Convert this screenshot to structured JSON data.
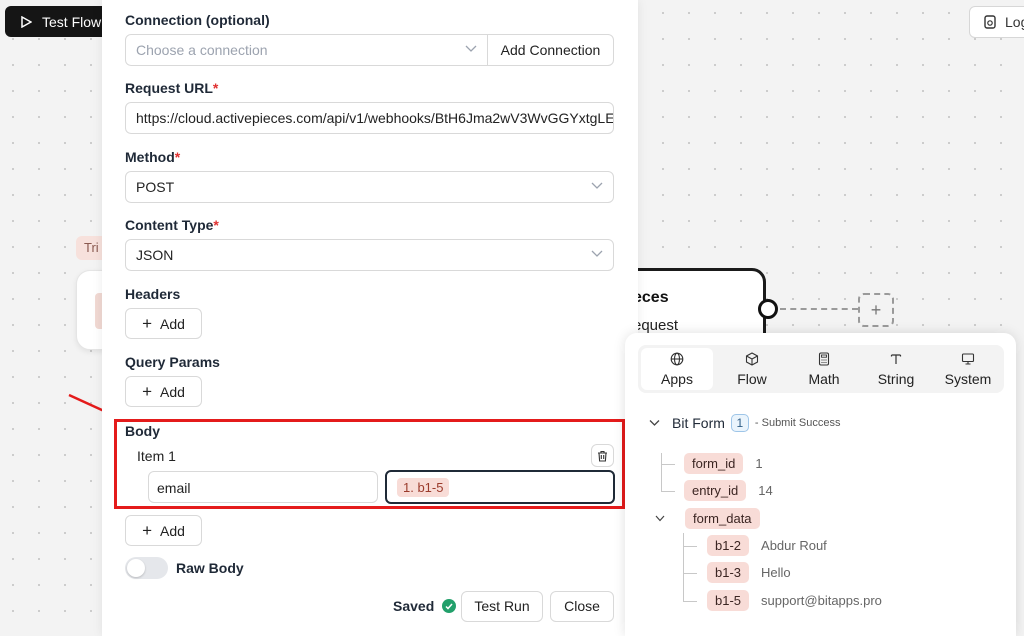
{
  "canvas": {
    "test_flow_label": "Test Flow",
    "logs_label": "Log",
    "trigger_tag": "Tri",
    "step_title": "eces",
    "step_subtitle": "equest",
    "add_step_symbol": "+"
  },
  "form": {
    "connection": {
      "label": "Connection (optional)",
      "placeholder": "Choose a connection",
      "add_button": "Add Connection"
    },
    "request_url": {
      "label": "Request URL",
      "required_mark": "*",
      "value": "https://cloud.activepieces.com/api/v1/webhooks/BtH6Jma2wV3WvGGYxtgLE"
    },
    "method": {
      "label": "Method",
      "required_mark": "*",
      "value": "POST"
    },
    "content_type": {
      "label": "Content Type",
      "required_mark": "*",
      "value": "JSON"
    },
    "headers": {
      "label": "Headers",
      "add_label": "Add"
    },
    "query_params": {
      "label": "Query Params",
      "add_label": "Add"
    },
    "body": {
      "label": "Body",
      "item_label": "Item 1",
      "key_value": "email",
      "value_chip": "1. b1-5",
      "add_label": "Add"
    },
    "raw_body_label": "Raw Body",
    "raw_body_enabled": false
  },
  "footer": {
    "saved_label": "Saved",
    "test_run_label": "Test Run",
    "close_label": "Close"
  },
  "data_selector": {
    "tabs": [
      {
        "label": "Apps",
        "icon": "globe-icon",
        "active": true
      },
      {
        "label": "Flow",
        "icon": "cube-icon",
        "active": false
      },
      {
        "label": "Math",
        "icon": "calculator-icon",
        "active": false
      },
      {
        "label": "String",
        "icon": "text-icon",
        "active": false
      },
      {
        "label": "System",
        "icon": "monitor-icon",
        "active": false
      }
    ],
    "source": {
      "name": "Bit Form",
      "step_number": "1",
      "event": "- Submit Success"
    },
    "fields": [
      {
        "key": "form_id",
        "value": "1"
      },
      {
        "key": "entry_id",
        "value": "14"
      }
    ],
    "form_data": {
      "key": "form_data",
      "children": [
        {
          "key": "b1-2",
          "value": "Abdur Rouf"
        },
        {
          "key": "b1-3",
          "value": "Hello"
        },
        {
          "key": "b1-5",
          "value": "support@bitapps.pro"
        }
      ]
    }
  },
  "colors": {
    "highlight": "#e41b1b",
    "chip_bg": "#f8dcd7",
    "saved_check": "#22a06b",
    "required": "#e03131"
  }
}
